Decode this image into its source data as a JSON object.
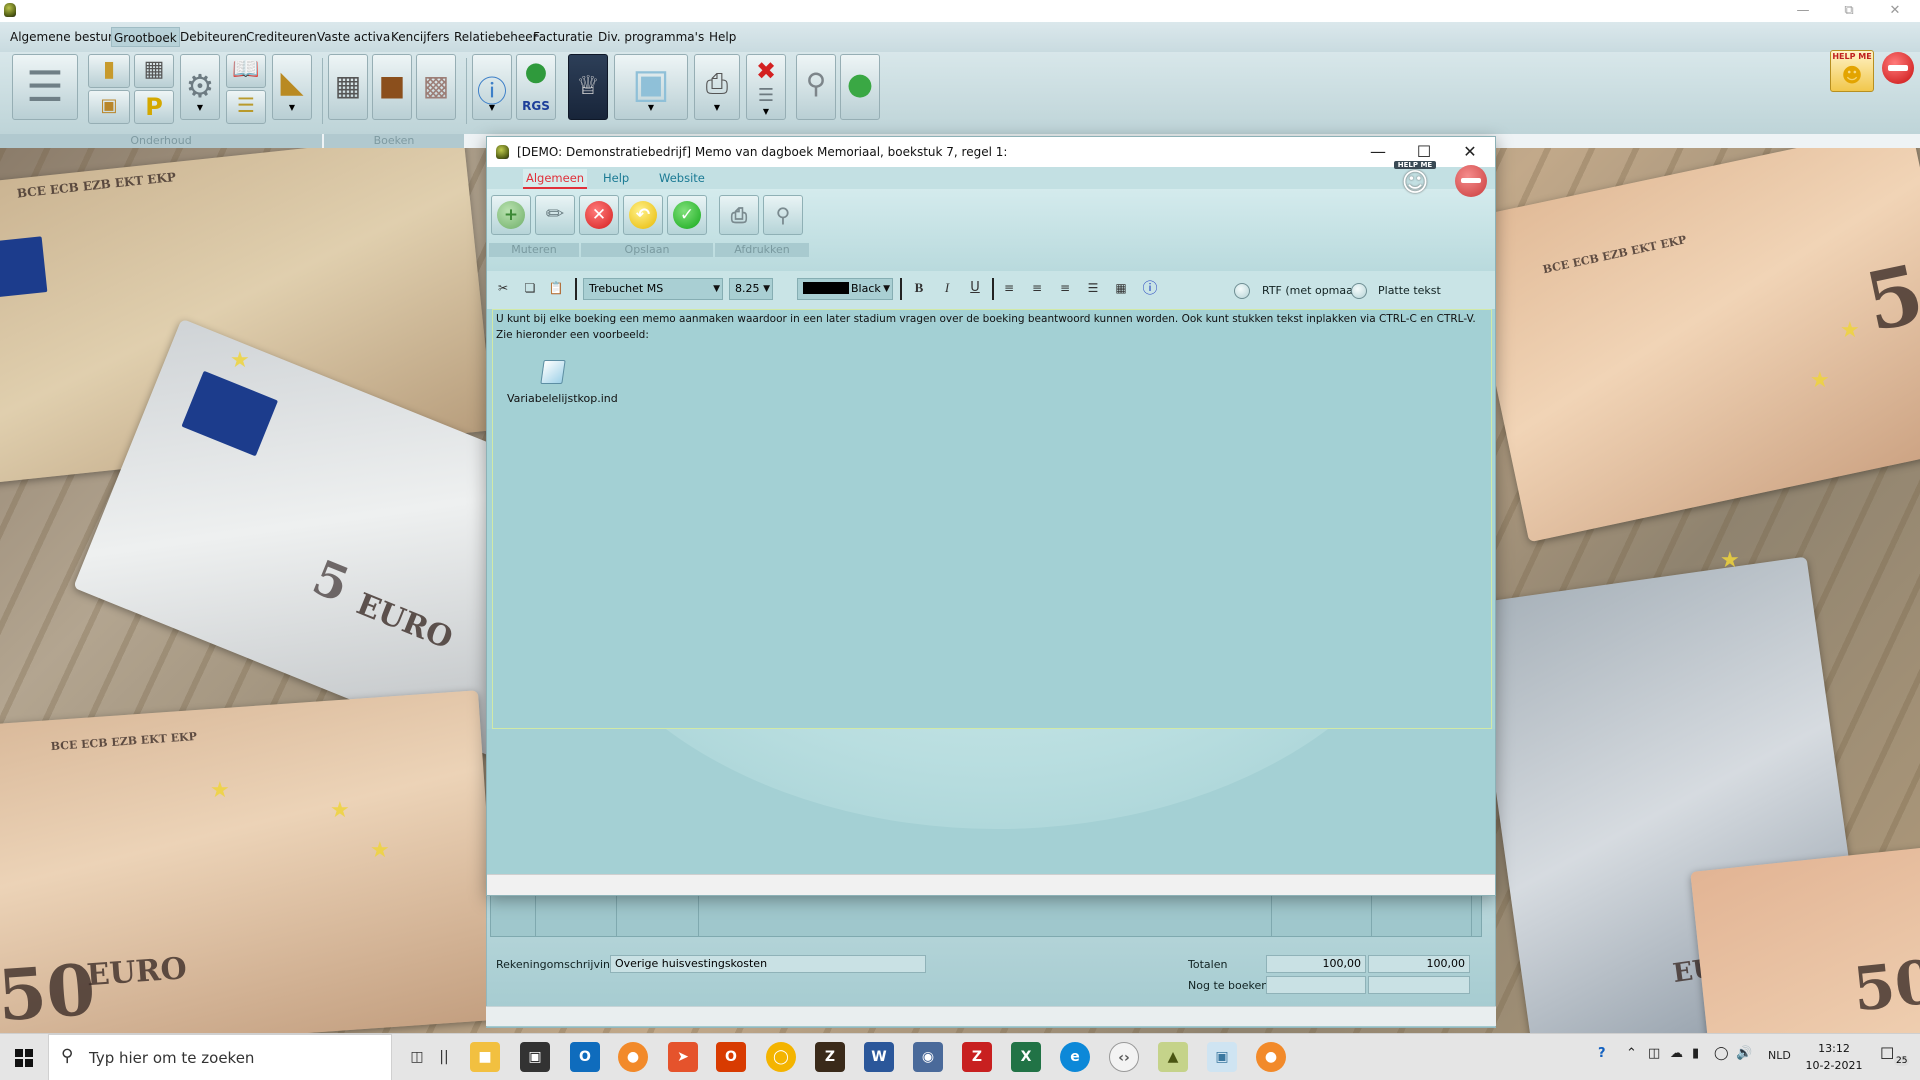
{
  "menu": [
    "Algemene besturing",
    "Grootboek",
    "Debiteuren",
    "Crediteuren",
    "Vaste activa",
    "Kencijfers",
    "Relatiebeheer",
    "Facturatie",
    "Div. programma's",
    "Help"
  ],
  "ribbon": {
    "groups": [
      "Onderhoud",
      "Boeken"
    ],
    "rgs_label": "RGS",
    "helpme_label": "HELP ME"
  },
  "dialog": {
    "title": "[DEMO: Demonstratiebedrijf]  Memo van dagboek Memoriaal, boekstuk 7, regel 1:",
    "tabs": [
      "Algemeen",
      "Help",
      "Website"
    ],
    "toolbar_groups": [
      "Muteren",
      "Opslaan",
      "Afdrukken"
    ],
    "helpme_label": "HELP ME",
    "format": {
      "font": "Trebuchet MS",
      "size": "8.25",
      "color_name": "Black",
      "bold": "B",
      "italic": "I",
      "underline": "U",
      "radio_rtf": "RTF (met opmaak",
      "radio_plain": "Platte tekst"
    },
    "memo_lines": [
      "U kunt bij elke boeking een memo aanmaken waardoor in een later stadium vragen over de boeking beantwoord kunnen worden. Ook kunt stukken tekst inplakken via CTRL-C en CTRL-V.",
      "Zie hieronder een voorbeeld:"
    ],
    "attachment": "Variabelelijstkop.ind"
  },
  "panel": {
    "account_label": "Rekeningomschrijving",
    "account_value": "Overige huisvestingskosten",
    "totals_label": "Totalen",
    "total_debit": "100,00",
    "total_credit": "100,00",
    "remaining_label": "Nog te boeken",
    "remaining_debit": "",
    "remaining_credit": ""
  },
  "banknotes": {
    "euro": "EURO",
    "five": "5",
    "fifty": "50",
    "serial": "BCE ECB EZB EKT EKP"
  },
  "taskbar": {
    "search_placeholder": "Typ hier om te zoeken",
    "language": "NLD",
    "time": "13:12",
    "date": "10-2-2021",
    "notifications": "25"
  },
  "colors": {
    "active_tab": "#e0303a",
    "tab_link": "#1a7a94",
    "dialog_bg": "#a7d3d6"
  }
}
